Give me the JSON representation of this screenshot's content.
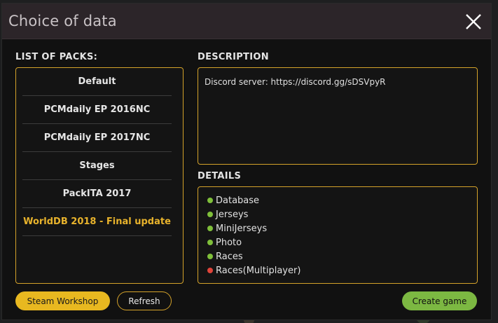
{
  "dialog": {
    "title": "Choice of data"
  },
  "packs": {
    "label": "LIST OF PACKS:",
    "items": [
      {
        "label": "Default",
        "selected": false
      },
      {
        "label": "PCMdaily EP 2016NC",
        "selected": false
      },
      {
        "label": "PCMdaily EP 2017NC",
        "selected": false
      },
      {
        "label": "Stages",
        "selected": false
      },
      {
        "label": "PackITA 2017",
        "selected": false
      },
      {
        "label": "WorldDB 2018 - Final update",
        "selected": true
      }
    ]
  },
  "description": {
    "label": "DESCRIPTION",
    "text": "Discord server: https://discord.gg/sDSVpyR"
  },
  "details": {
    "label": "DETAILS",
    "items": [
      {
        "label": "Database",
        "status": "green"
      },
      {
        "label": "Jerseys",
        "status": "green"
      },
      {
        "label": "MiniJerseys",
        "status": "green"
      },
      {
        "label": "Photo",
        "status": "green"
      },
      {
        "label": "Races",
        "status": "green"
      },
      {
        "label": "Races(Multiplayer)",
        "status": "red"
      }
    ]
  },
  "buttons": {
    "steam_workshop": "Steam Workshop",
    "refresh": "Refresh",
    "create_game": "Create game"
  },
  "colors": {
    "accent": "#d4a22a",
    "selected_text": "#e8b32c",
    "ok": "#7fbf3a",
    "error": "#e0443a"
  }
}
